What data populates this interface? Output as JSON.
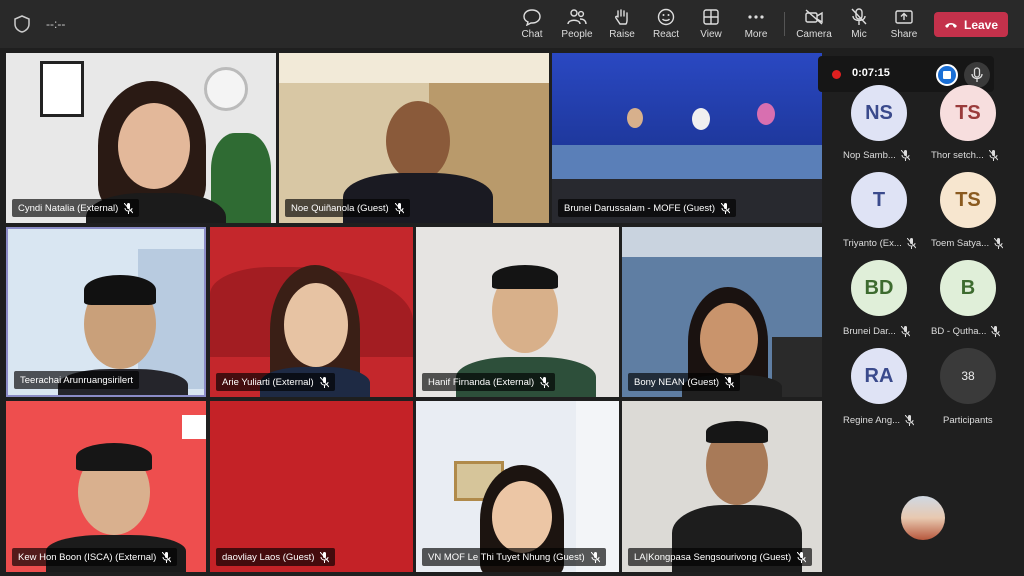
{
  "topbar": {
    "timer": "--:--",
    "buttons": [
      {
        "label": "Chat",
        "icon": "chat-icon"
      },
      {
        "label": "People",
        "icon": "people-icon"
      },
      {
        "label": "Raise",
        "icon": "raise-hand-icon"
      },
      {
        "label": "React",
        "icon": "react-icon"
      },
      {
        "label": "View",
        "icon": "view-icon"
      },
      {
        "label": "More",
        "icon": "more-icon"
      },
      {
        "label": "Camera",
        "icon": "camera-off-icon"
      },
      {
        "label": "Mic",
        "icon": "mic-off-icon"
      },
      {
        "label": "Share",
        "icon": "share-icon"
      }
    ],
    "leave_label": "Leave"
  },
  "recording": {
    "elapsed": "0:07:15"
  },
  "tiles": [
    {
      "name": "Cyndi Natalia (External)"
    },
    {
      "name": "Noe Quiñanola (Guest)"
    },
    {
      "name": "Brunei Darussalam - MOFE (Guest)"
    },
    {
      "name": "Teerachai Arunruangsirilert"
    },
    {
      "name": "Arie Yuliarti (External)"
    },
    {
      "name": "Hanif Firnanda (External)"
    },
    {
      "name": "Bony NEAN (Guest)"
    },
    {
      "name": "Kew Hon Boon (ISCA) (External)"
    },
    {
      "name": "daovliay Laos (Guest)"
    },
    {
      "name": "VN MOF Le Thi Tuyet Nhung (Guest)"
    },
    {
      "name": "LA|Kongpasa Sengsourivong (Guest)"
    }
  ],
  "participants_panel": {
    "avatars": [
      {
        "initials": "NS",
        "name": "Nop Samb...",
        "bg": "#dfe3f5",
        "fg": "#3a4a8c"
      },
      {
        "initials": "TS",
        "name": "Thor setch...",
        "bg": "#f7dede",
        "fg": "#9a3b3b"
      },
      {
        "initials": "T",
        "name": "Triyanto (Ex...",
        "bg": "#dfe3f5",
        "fg": "#3a4a8c"
      },
      {
        "initials": "TS",
        "name": "Toem Satya...",
        "bg": "#f7e6cf",
        "fg": "#8a5a1f"
      },
      {
        "initials": "BD",
        "name": "Brunei Dar...",
        "bg": "#e0efd9",
        "fg": "#3d6b2f"
      },
      {
        "initials": "B",
        "name": "BD - Qutha...",
        "bg": "#e0efd9",
        "fg": "#3d6b2f"
      },
      {
        "initials": "RA",
        "name": "Regine Ang...",
        "bg": "#dfe3f5",
        "fg": "#3a4a8c"
      }
    ],
    "overflow_count": "38",
    "overflow_label": "Participants"
  },
  "colors": {
    "accent": "#c4314b",
    "active_border": "#8b8cc7"
  }
}
